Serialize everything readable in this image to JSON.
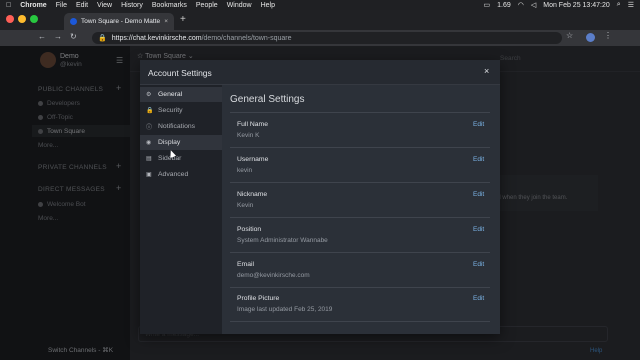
{
  "menubar": {
    "app": "Chrome",
    "items": [
      "File",
      "Edit",
      "View",
      "History",
      "Bookmarks",
      "People",
      "Window",
      "Help"
    ],
    "battery": "1.69",
    "datetime": "Mon Feb 25  13:47:20"
  },
  "browser": {
    "tab_title": "Town Square - Demo Matterm",
    "url_host": "https://chat.kevinkirsche.com",
    "url_path": "/demo/channels/town-square"
  },
  "sidebar": {
    "team": "Demo",
    "username": "@kevin",
    "public_header": "PUBLIC CHANNELS",
    "public_channels": [
      "Developers",
      "Off-Topic",
      "Town Square"
    ],
    "public_more": "More...",
    "private_header": "PRIVATE CHANNELS",
    "dm_header": "DIRECT MESSAGES",
    "dms": [
      "Welcome Bot"
    ],
    "dm_more": "More...",
    "switch_channels": "Switch Channels - ⌘K"
  },
  "channel": {
    "name": "Town Square",
    "search_placeholder": "Search",
    "message_placeholder": "Write a message...",
    "notice_text": "el when they join the team.",
    "help": "Help"
  },
  "modal": {
    "title": "Account Settings",
    "close": "×",
    "nav": [
      {
        "icon": "gear-icon",
        "glyph": "⚙",
        "label": "General"
      },
      {
        "icon": "lock-icon",
        "glyph": "🔒",
        "label": "Security"
      },
      {
        "icon": "info-icon",
        "glyph": "ⓘ",
        "label": "Notifications"
      },
      {
        "icon": "eye-icon",
        "glyph": "◉",
        "label": "Display"
      },
      {
        "icon": "sidebar-icon",
        "glyph": "▤",
        "label": "Sidebar"
      },
      {
        "icon": "advanced-icon",
        "glyph": "▣",
        "label": "Advanced"
      }
    ],
    "content_title": "General Settings",
    "edit_label": "Edit",
    "settings": [
      {
        "label": "Full Name",
        "value": "Kevin K"
      },
      {
        "label": "Username",
        "value": "kevin"
      },
      {
        "label": "Nickname",
        "value": "Kevin"
      },
      {
        "label": "Position",
        "value": "System Administrator Wannabe"
      },
      {
        "label": "Email",
        "value": "demo@kevinkirsche.com"
      },
      {
        "label": "Profile Picture",
        "value": "Image last updated Feb 25, 2019"
      }
    ]
  }
}
